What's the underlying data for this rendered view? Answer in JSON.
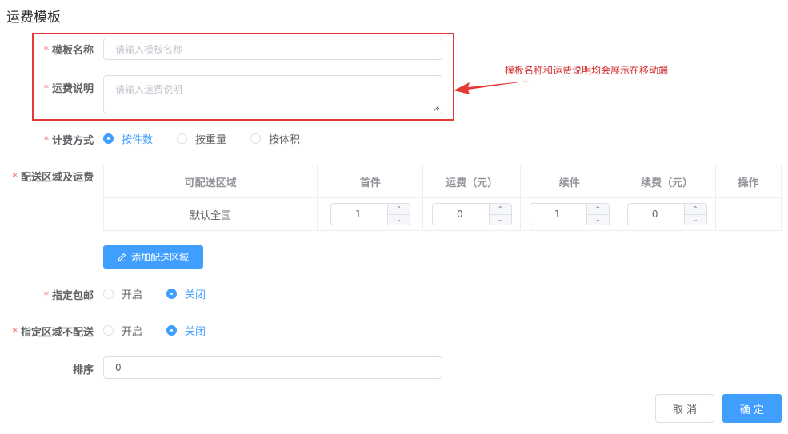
{
  "page": {
    "title": "运费模板"
  },
  "annotation": {
    "text": "模板名称和运费说明均会展示在移动端",
    "color": "#e53935"
  },
  "form": {
    "required_mark": "*",
    "template_name": {
      "label": "模板名称",
      "placeholder": "请输入模板名称",
      "value": ""
    },
    "shipping_desc": {
      "label": "运费说明",
      "placeholder": "请输入运费说明",
      "value": ""
    },
    "billing_method": {
      "label": "计费方式",
      "options": [
        "按件数",
        "按重量",
        "按体积"
      ],
      "selected": "按件数"
    },
    "delivery_regions": {
      "label": "配送区域及运费",
      "columns": [
        "可配送区域",
        "首件",
        "运费（元）",
        "续件",
        "续费（元）",
        "操作"
      ],
      "rows": [
        {
          "region": "默认全国",
          "first_item": "1",
          "first_fee": "0",
          "extra_item": "1",
          "extra_fee": "0"
        }
      ],
      "add_button": "添加配送区域"
    },
    "free_shipping": {
      "label": "指定包邮",
      "options": [
        "开启",
        "关闭"
      ],
      "selected": "关闭"
    },
    "no_delivery": {
      "label": "指定区域不配送",
      "options": [
        "开启",
        "关闭"
      ],
      "selected": "关闭"
    },
    "sort": {
      "label": "排序",
      "value": "0"
    }
  },
  "footer": {
    "cancel": "取 消",
    "confirm": "确 定"
  },
  "colors": {
    "primary": "#409eff",
    "required": "#f56c6c",
    "highlight": "#e53935"
  },
  "icons": {
    "stepper_up": "chevron-up-icon",
    "stepper_down": "chevron-down-icon",
    "add": "edit-icon"
  }
}
